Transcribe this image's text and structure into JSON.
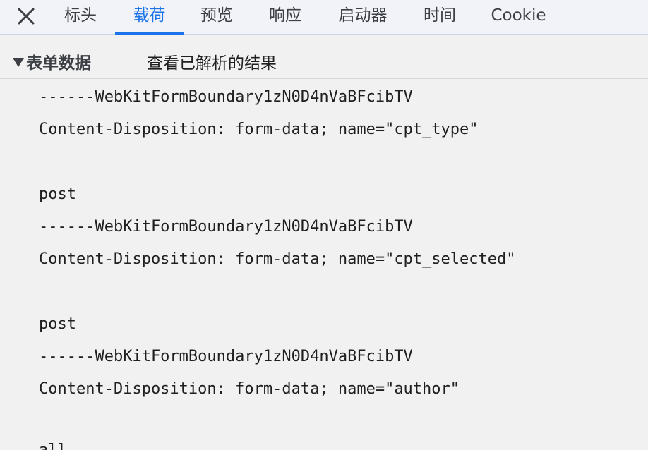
{
  "tabs": {
    "close_label": "close",
    "items": [
      "标头",
      "载荷",
      "预览",
      "响应",
      "启动器",
      "时间",
      "Cookie"
    ],
    "active_index": 1,
    "active_color": "#1a73e8"
  },
  "section": {
    "title": "表单数据",
    "view_parsed": "查看已解析的结果"
  },
  "payload_lines": [
    "------WebKitFormBoundary1zN0D4nVaBFcibTV",
    "Content-Disposition: form-data; name=\"cpt_type\"",
    "",
    "post",
    "------WebKitFormBoundary1zN0D4nVaBFcibTV",
    "Content-Disposition: form-data; name=\"cpt_selected\"",
    "",
    "post",
    "------WebKitFormBoundary1zN0D4nVaBFcibTV",
    "Content-Disposition: form-data; name=\"author\"",
    "",
    "all"
  ]
}
